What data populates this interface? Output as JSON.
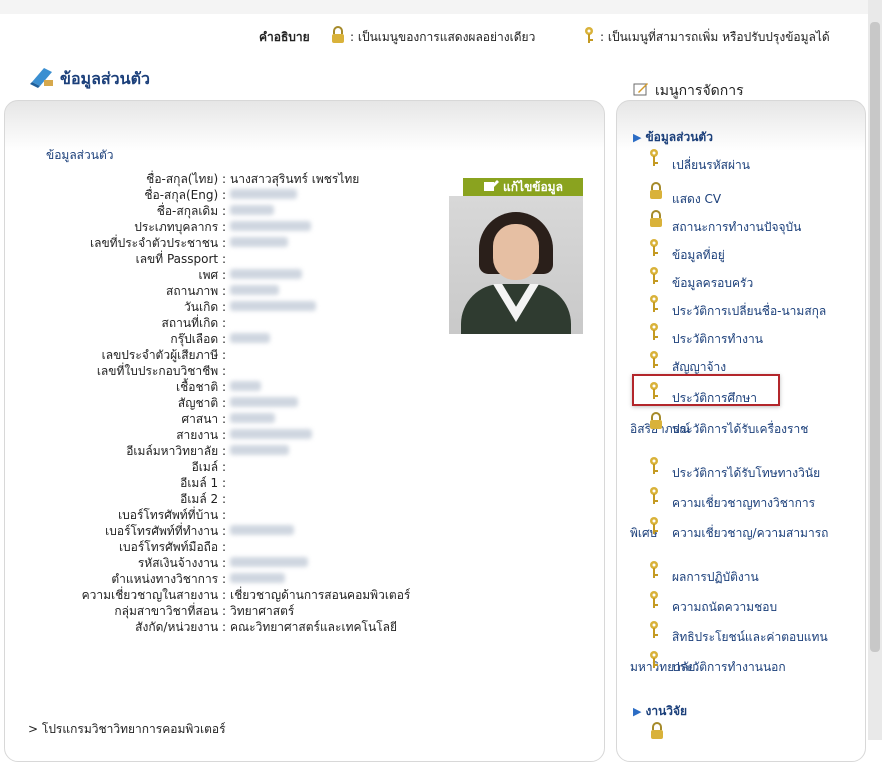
{
  "legend": {
    "title": "คำอธิบาย",
    "lock_text": ": เป็นเมนูของการแสดงผลอย่างเดียว",
    "key_text": ": เป็นเมนูที่สามารถเพิ่ม หรือปรับปรุงข้อมูลได้"
  },
  "section": {
    "title": "ข้อมูลส่วนตัว",
    "sublink": "ข้อมูลส่วนตัว",
    "edit_label": "แก้ไขข้อมูล"
  },
  "personal": [
    {
      "label": "ชื่อ-สกุล(ไทย) :",
      "value": "นางสาวสุรินทร์ เพชรไทย"
    },
    {
      "label": "ชื่อ-สกุล(Eng) :",
      "value": ""
    },
    {
      "label": "ชื่อ-สกุลเดิม :",
      "value": ""
    },
    {
      "label": "ประเภทบุคลากร :",
      "value": ""
    },
    {
      "label": "เลขที่ประจำตัวประชาชน :",
      "value": ""
    },
    {
      "label": "เลขที่ Passport :",
      "value": ""
    },
    {
      "label": "เพศ :",
      "value": ""
    },
    {
      "label": "สถานภาพ :",
      "value": ""
    },
    {
      "label": "วันเกิด :",
      "value": ""
    },
    {
      "label": "สถานที่เกิด :",
      "value": ""
    },
    {
      "label": "กรุ๊ปเลือด :",
      "value": ""
    },
    {
      "label": "เลขประจำตัวผู้เสียภาษี :",
      "value": ""
    },
    {
      "label": "เลขที่ใบประกอบวิชาชีพ :",
      "value": ""
    },
    {
      "label": "เชื้อชาติ :",
      "value": ""
    },
    {
      "label": "สัญชาติ :",
      "value": ""
    },
    {
      "label": "ศาสนา :",
      "value": ""
    },
    {
      "label": "สายงาน :",
      "value": ""
    },
    {
      "label": "อีเมล์มหาวิทยาลัย :",
      "value": ""
    },
    {
      "label": "อีเมล์ :",
      "value": ""
    },
    {
      "label": "อีเมล์ 1 :",
      "value": ""
    },
    {
      "label": "อีเมล์ 2 :",
      "value": ""
    },
    {
      "label": "เบอร์โทรศัพท์ที่บ้าน :",
      "value": ""
    },
    {
      "label": "เบอร์โทรศัพท์ที่ทำงาน :",
      "value": ""
    },
    {
      "label": "เบอร์โทรศัพท์มือถือ :",
      "value": ""
    },
    {
      "label": "รหัสเงินจ้างงาน :",
      "value": ""
    },
    {
      "label": "ตำแหน่งทางวิชาการ :",
      "value": ""
    },
    {
      "label": "ความเชี่ยวชาญในสายงาน :",
      "value": "เชี่ยวชาญด้านการสอนคอมพิวเตอร์"
    },
    {
      "label": "กลุ่มสาขาวิชาที่สอน :",
      "value": "วิทยาศาสตร์"
    },
    {
      "label": "สังกัด/หน่วยงาน :",
      "value": "คณะวิทยาศาสตร์และเทคโนโลยี"
    }
  ],
  "program_line": "> โปรแกรมวิชาวิทยาการคอมพิวเตอร์",
  "menu": {
    "title": "เมนูการจัดการ",
    "group1": "ข้อมูลส่วนตัว",
    "group2": "งานวิจัย",
    "items": [
      {
        "icon": "key-icon",
        "label": "เปลี่ยนรหัสผ่าน"
      },
      {
        "icon": "lock-icon",
        "label": "แสดง CV"
      },
      {
        "icon": "lock-icon",
        "label": "สถานะการทำงานปัจจุบัน"
      },
      {
        "icon": "key-icon",
        "label": "ข้อมูลที่อยู่"
      },
      {
        "icon": "key-icon",
        "label": "ข้อมูลครอบครัว"
      },
      {
        "icon": "key-icon",
        "label": "ประวัติการเปลี่ยนชื่อ-นามสกุล"
      },
      {
        "icon": "key-icon",
        "label": "ประวัติการทำงาน"
      },
      {
        "icon": "key-icon",
        "label": "สัญญาจ้าง"
      },
      {
        "icon": "key-icon",
        "label": "ประวัติการศึกษา"
      },
      {
        "icon": "lock-icon",
        "label": "ประวัติการได้รับเครื่องราช",
        "label2": "อิสริยาภรณ์"
      },
      {
        "icon": "key-icon",
        "label": "ประวัติการได้รับโทษทางวินัย"
      },
      {
        "icon": "key-icon",
        "label": "ความเชี่ยวชาญทางวิชาการ"
      },
      {
        "icon": "key-icon",
        "label": "ความเชี่ยวชาญ/ความสามารถ",
        "label2": "พิเศษ"
      },
      {
        "icon": "key-icon",
        "label": "ผลการปฏิบัติงาน"
      },
      {
        "icon": "key-icon",
        "label": "ความถนัดความชอบ"
      },
      {
        "icon": "key-icon",
        "label": "สิทธิประโยชน์และค่าตอบแทน"
      },
      {
        "icon": "key-icon",
        "label": "ประวัติการทำงานนอก",
        "label2": "มหาวิทยาลัย"
      }
    ]
  },
  "colors": {
    "link": "#1b3f7a",
    "edit_button": "#8aa31f",
    "highlight": "#b3262b"
  }
}
